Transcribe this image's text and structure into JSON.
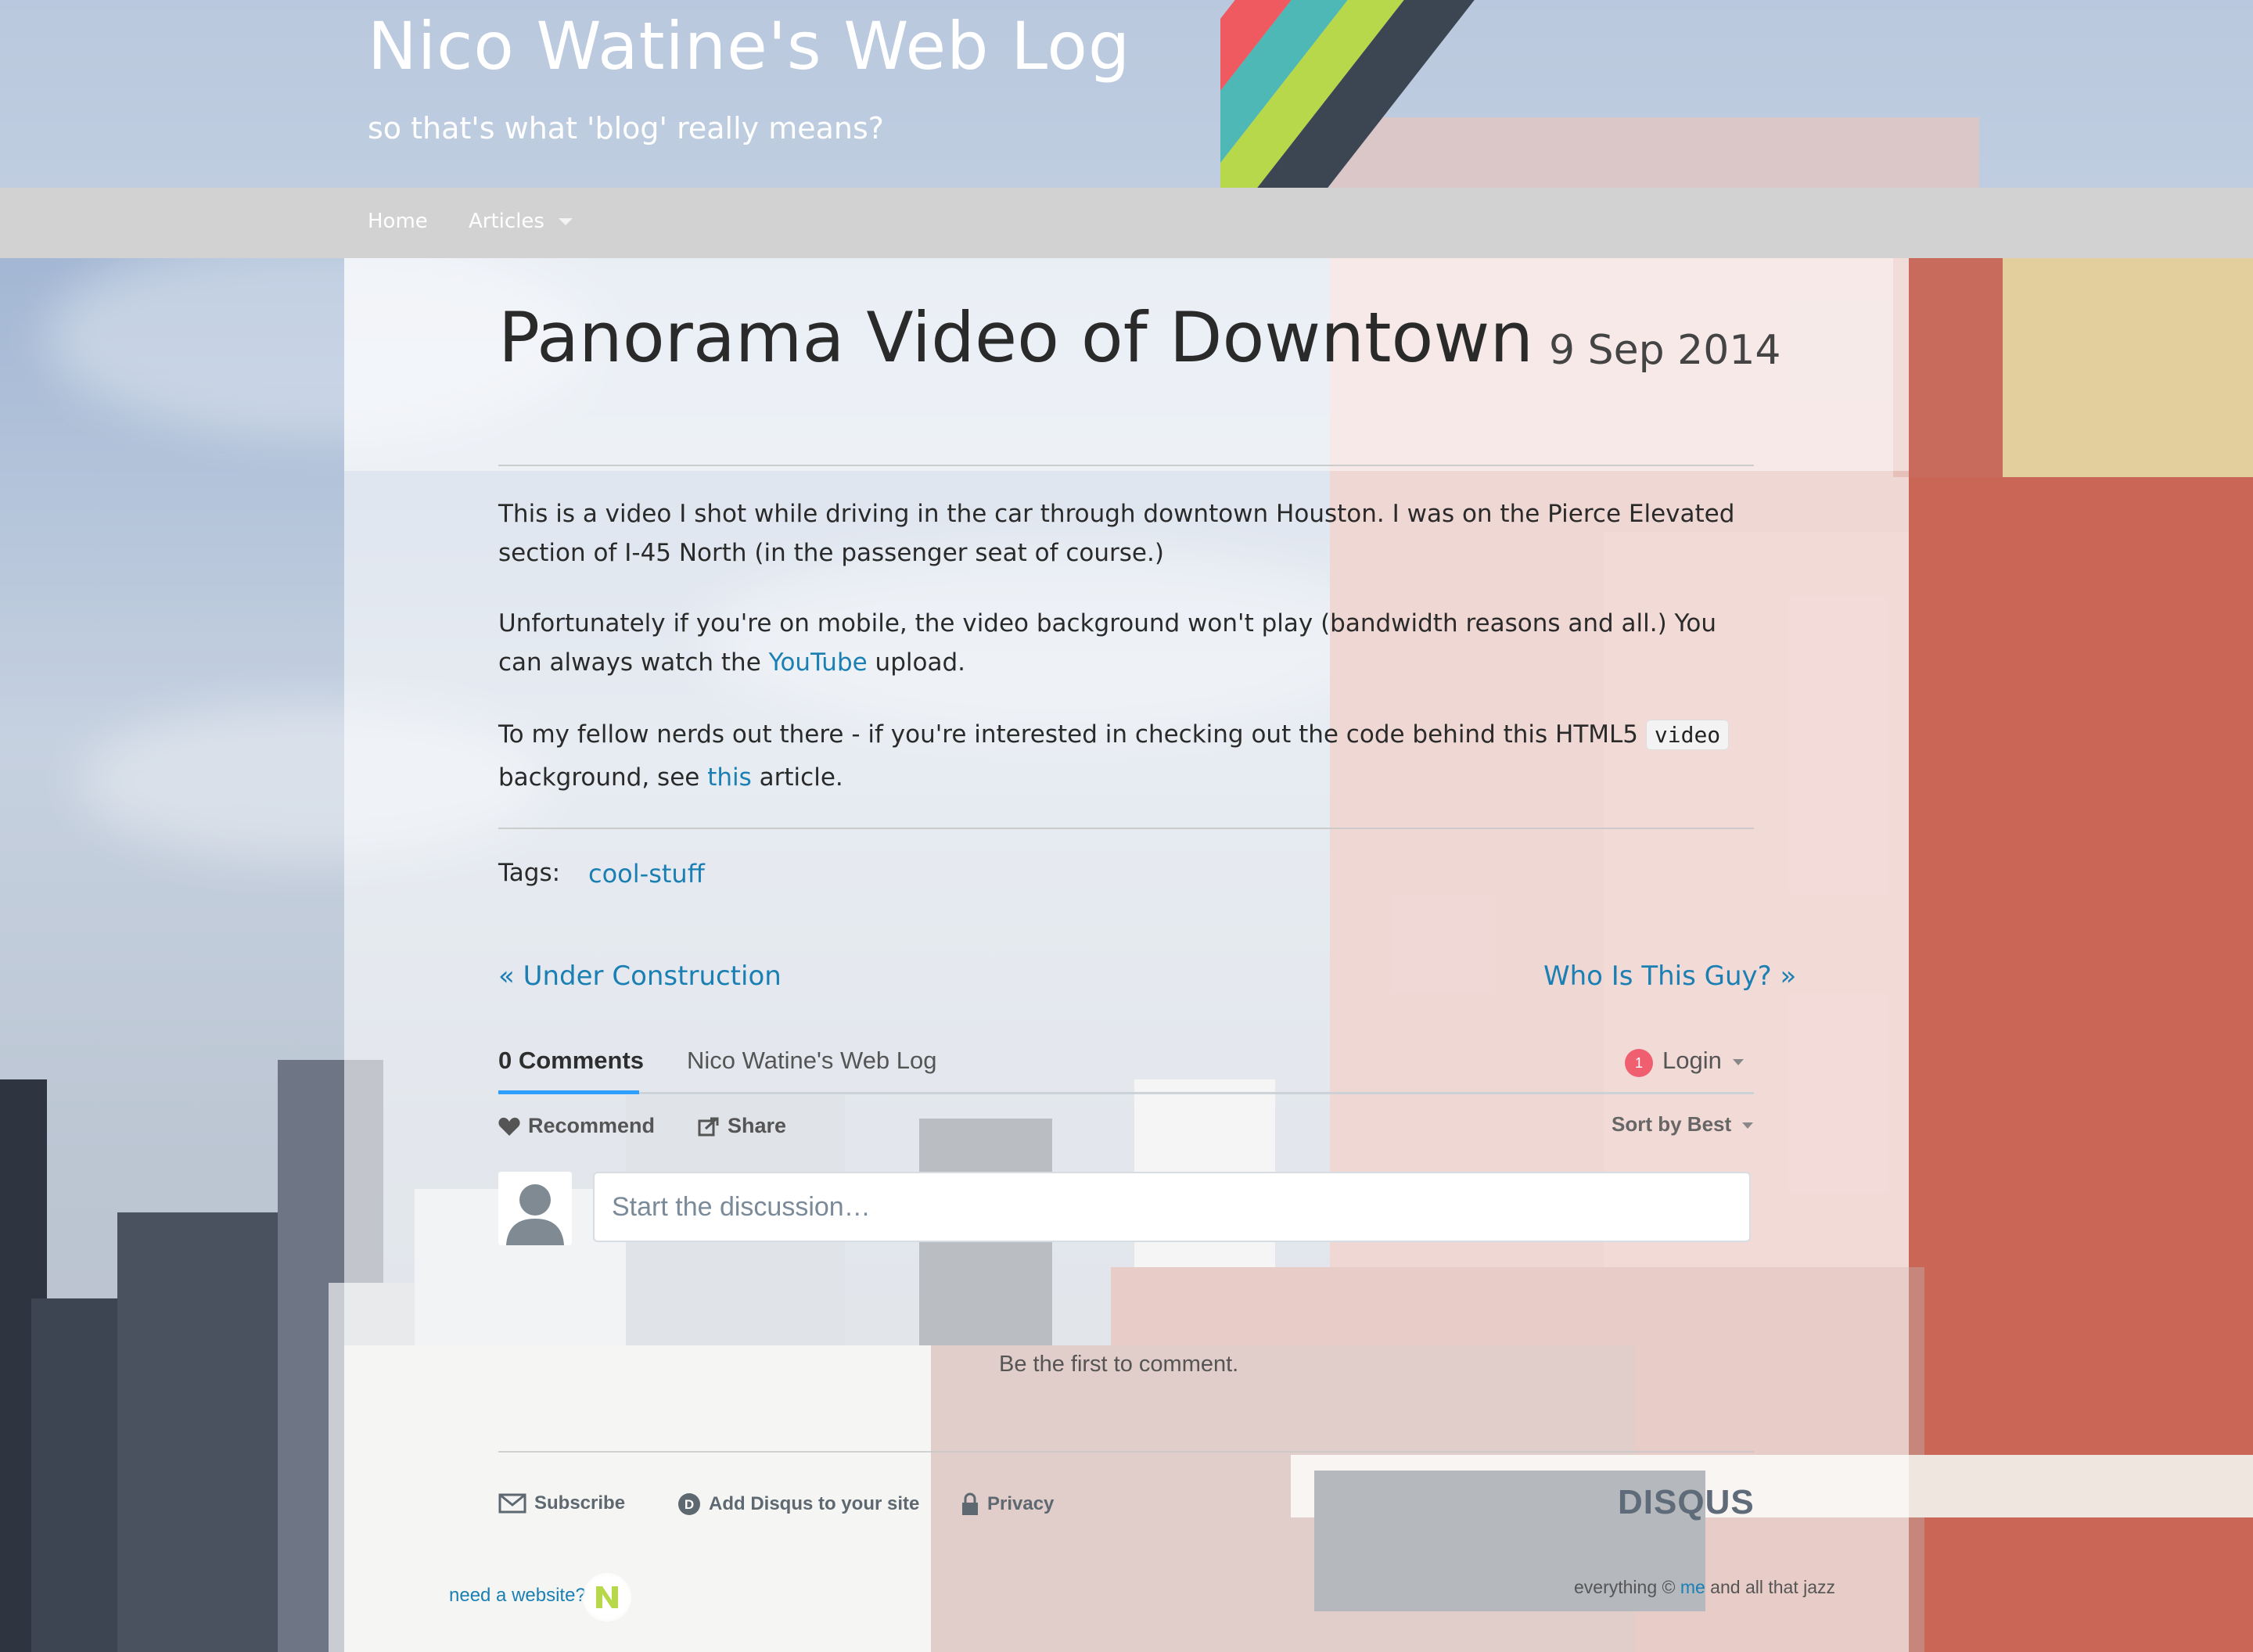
{
  "site": {
    "title": "Nico Watine's Web Log",
    "subtitle": "so that's what 'blog' really means?",
    "stripe_colors": [
      "#ee5a5f",
      "#4db8b5",
      "#b7d84a",
      "#3c4653"
    ]
  },
  "nav": {
    "home": "Home",
    "articles": "Articles"
  },
  "post": {
    "title": "Panorama Video of Downtown",
    "date": "9 Sep 2014",
    "p1": "This is a video I shot while driving in the car through downtown Houston. I was on the Pierce Elevated section of I-45 North (in the passenger seat of course.)",
    "p2_before": "Unfortunately if you're on mobile, the video background won't play (bandwidth reasons and all.) You can always watch the ",
    "p2_link": "YouTube",
    "p2_after": " upload.",
    "p3_before": "To my fellow nerds out there - if you're interested in checking out the code behind this HTML5 ",
    "p3_code": "video",
    "p3_mid": " background, see ",
    "p3_link": "this",
    "p3_after": " article.",
    "tags_label": "Tags:",
    "tag": "cool-stuff",
    "prev": "« Under Construction",
    "next": "Who Is This Guy? »"
  },
  "disqus": {
    "comments_tab": "0 Comments",
    "site_tab": "Nico Watine's Web Log",
    "badge": "1",
    "login": "Login",
    "recommend": "Recommend",
    "share": "Share",
    "sort": "Sort by Best",
    "placeholder": "Start the discussion…",
    "empty": "Be the first to comment.",
    "subscribe": "Subscribe",
    "add": "Add Disqus to your site",
    "privacy": "Privacy",
    "logo": "DISQUS"
  },
  "footer": {
    "need": "need a website?",
    "copy_before": "everything © ",
    "copy_link": "me",
    "copy_after": " and all that jazz"
  },
  "colors": {
    "link": "#1a7fb3",
    "nav_bg": "#d2d2d2",
    "badge": "#f05f70"
  }
}
